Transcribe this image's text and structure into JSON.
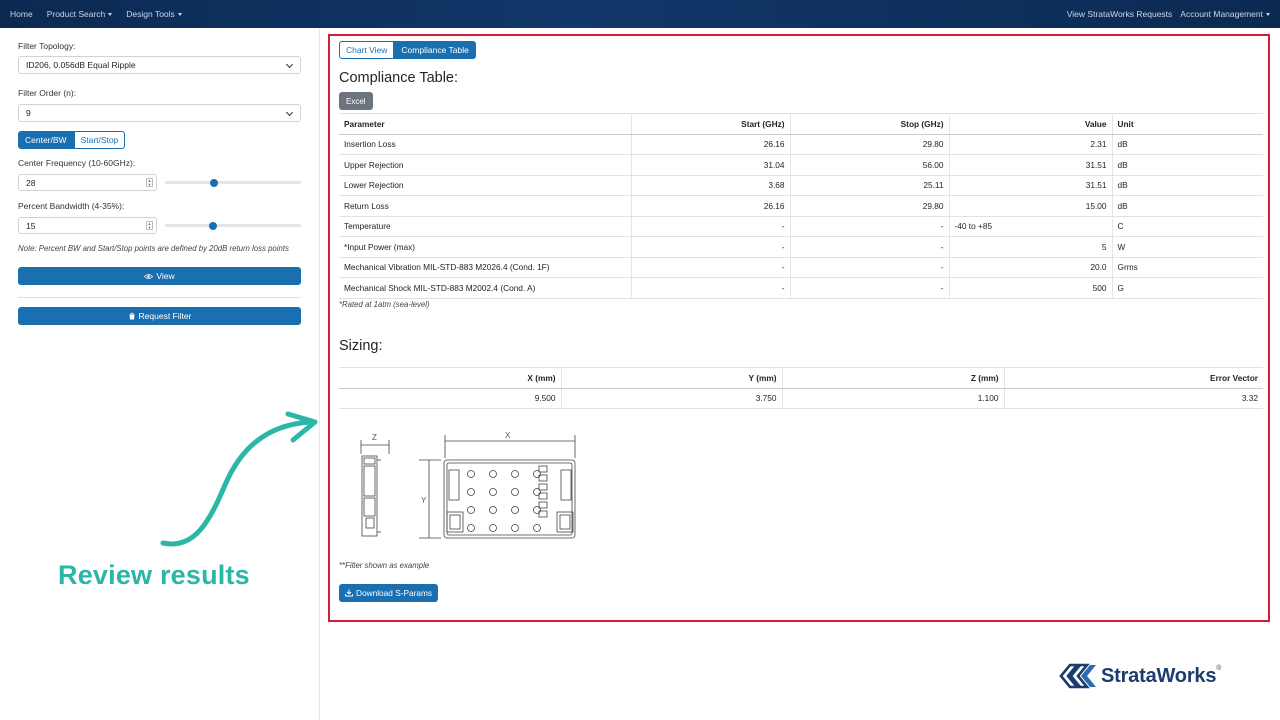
{
  "nav": {
    "home": "Home",
    "product_search": "Product Search",
    "design_tools": "Design Tools",
    "view_requests": "View StrataWorks Requests",
    "account": "Account Management"
  },
  "sidebar": {
    "topology_label": "Filter Topology:",
    "topology_value": "ID206, 0.056dB Equal Ripple",
    "order_label": "Filter Order (n):",
    "order_value": "9",
    "mode_center": "Center/BW",
    "mode_startstop": "Start/Stop",
    "center_label": "Center Frequency (10-60GHz):",
    "center_value": "28",
    "center_slider_fraction": 0.36,
    "bw_label": "Percent Bandwidth (4-35%):",
    "bw_value": "15",
    "bw_slider_fraction": 0.35,
    "note": "Note: Percent BW and Start/Stop points are defined by 20dB return loss points",
    "view_button": "View",
    "request_button": "Request Filter"
  },
  "annotation": {
    "text": "Review results",
    "color": "#2bb6a8"
  },
  "main": {
    "tab_chart": "Chart View",
    "tab_table": "Compliance Table",
    "compliance_title": "Compliance Table:",
    "excel_button": "Excel",
    "compliance_headers": [
      "Parameter",
      "Start (GHz)",
      "Stop (GHz)",
      "Value",
      "Unit"
    ],
    "compliance_rows": [
      [
        "Insertion Loss",
        "26.16",
        "29.80",
        "2.31",
        "dB"
      ],
      [
        "Upper Rejection",
        "31.04",
        "56.00",
        "31.51",
        "dB"
      ],
      [
        "Lower Rejection",
        "3.68",
        "25.11",
        "31.51",
        "dB"
      ],
      [
        "Return Loss",
        "26.16",
        "29.80",
        "15.00",
        "dB"
      ],
      [
        "Temperature",
        "-",
        "-",
        "-40 to +85",
        "C"
      ],
      [
        "*Input Power (max)",
        "-",
        "-",
        "5",
        "W"
      ],
      [
        "Mechanical Vibration MIL-STD-883 M2026.4 (Cond. 1F)",
        "-",
        "-",
        "20.0",
        "Grms"
      ],
      [
        "Mechanical Shock MIL-STD-883 M2002.4 (Cond. A)",
        "-",
        "-",
        "500",
        "G"
      ]
    ],
    "rated_note": "*Rated at 1atm (sea-level)",
    "sizing_title": "Sizing:",
    "sizing_headers": [
      "X (mm)",
      "Y (mm)",
      "Z (mm)",
      "Error Vector"
    ],
    "sizing_row": [
      "9.500",
      "3.750",
      "1.100",
      "3.32"
    ],
    "drawing_labels": {
      "z": "Z",
      "x": "X",
      "y": "Y"
    },
    "example_note": "**Filter shown as example",
    "download_button": "Download S-Params"
  },
  "logo": {
    "text": "StrataWorks",
    "reg": "®"
  },
  "colors": {
    "primary": "#1a6fb0",
    "navbar": "#0b2a52",
    "highlight_border": "#d41c3c",
    "annotation": "#2bb6a8",
    "brand": "#1b3d6e"
  }
}
